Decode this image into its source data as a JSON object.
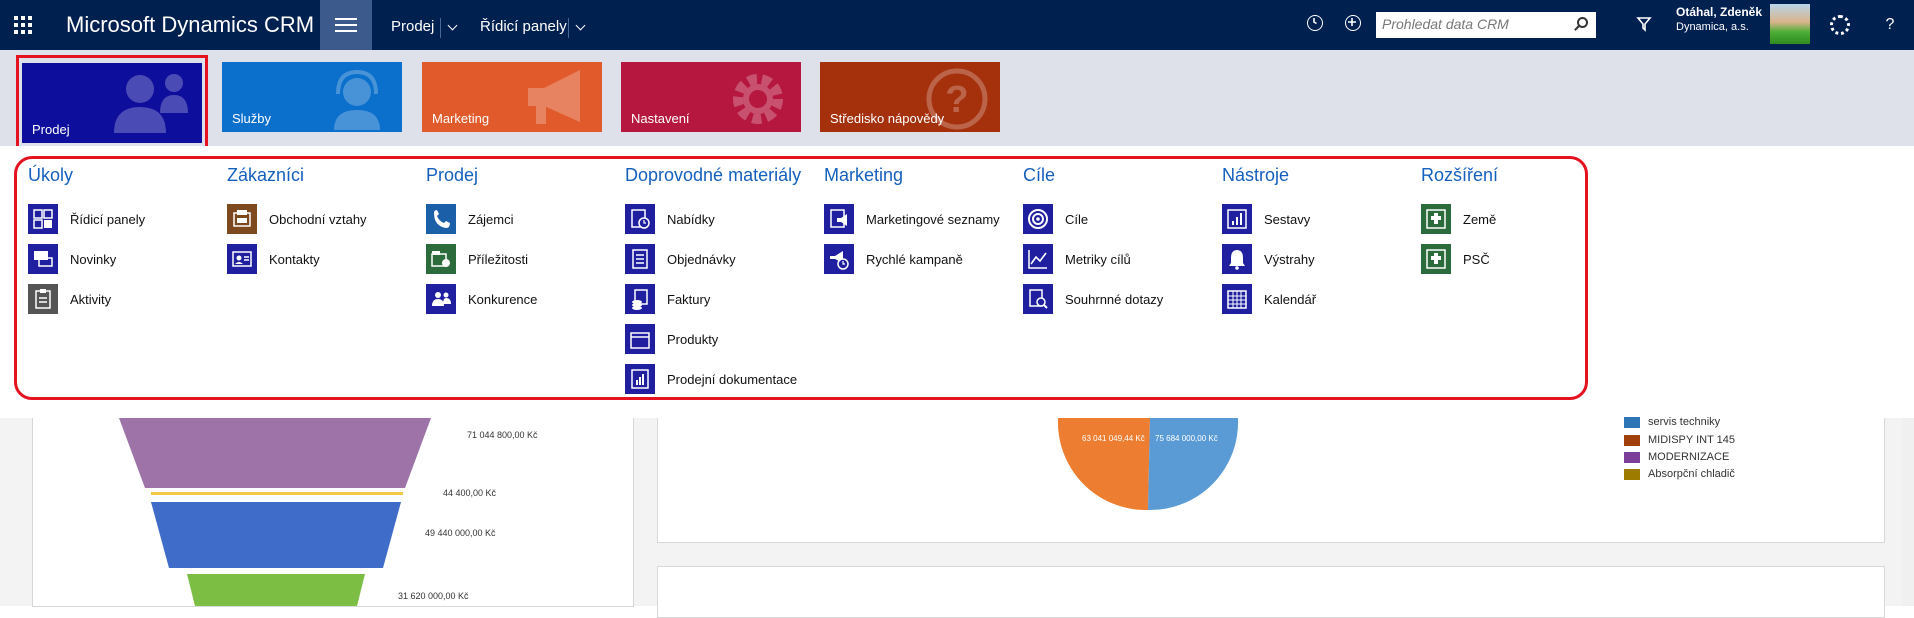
{
  "topbar": {
    "app_title": "Microsoft Dynamics CRM",
    "nav_area": "Prodej",
    "nav_page": "Řídicí panely",
    "search_placeholder": "Prohledat data CRM",
    "user_name": "Otáhal, Zdeněk",
    "user_org": "Dynamica, a.s.",
    "help": "?"
  },
  "tiles": [
    {
      "label": "Prodej",
      "color": "#0e0e9c",
      "selected": true
    },
    {
      "label": "Služby",
      "color": "#0b6fcc"
    },
    {
      "label": "Marketing",
      "color": "#e05a2b"
    },
    {
      "label": "Nastavení",
      "color": "#b5173f"
    },
    {
      "label": "Středisko nápovědy",
      "color": "#a4300c"
    }
  ],
  "menu": {
    "columns": [
      {
        "title": "Úkoly",
        "items": [
          "Řídicí panely",
          "Novinky",
          "Aktivity"
        ]
      },
      {
        "title": "Zákazníci",
        "items": [
          "Obchodní vztahy",
          "Kontakty"
        ]
      },
      {
        "title": "Prodej",
        "items": [
          "Zájemci",
          "Příležitosti",
          "Konkurence"
        ]
      },
      {
        "title": "Doprovodné materiály",
        "items": [
          "Nabídky",
          "Objednávky",
          "Faktury",
          "Produkty",
          "Prodejní dokumentace"
        ]
      },
      {
        "title": "Marketing",
        "items": [
          "Marketingové seznamy",
          "Rychlé kampaně"
        ]
      },
      {
        "title": "Cíle",
        "items": [
          "Cíle",
          "Metriky cílů",
          "Souhrnné dotazy"
        ]
      },
      {
        "title": "Nástroje",
        "items": [
          "Sestavy",
          "Výstrahy",
          "Kalendář"
        ]
      },
      {
        "title": "Rozšíření",
        "items": [
          "Země",
          "PSČ"
        ]
      }
    ]
  },
  "background": {
    "funnel_labels": [
      "71 044 800,00 Kč",
      "44 400,00 Kč",
      "49 440 000,00 Kč",
      "31 620 000,00 Kč"
    ],
    "pie_labels": [
      "63 041 049,44 Kč",
      "75 684 000,00 Kč"
    ],
    "legend": [
      {
        "label": "servis techniky",
        "color": "#2e75b6"
      },
      {
        "label": "MIDISPY INT 145",
        "color": "#a0400c"
      },
      {
        "label": "MODERNIZACE",
        "color": "#7b3f9a"
      },
      {
        "label": "Absorpční chladič",
        "color": "#9c7b00"
      }
    ]
  },
  "colors": {
    "accent": "#002050",
    "heading": "#1560bd",
    "highlight": "#e5121f"
  }
}
